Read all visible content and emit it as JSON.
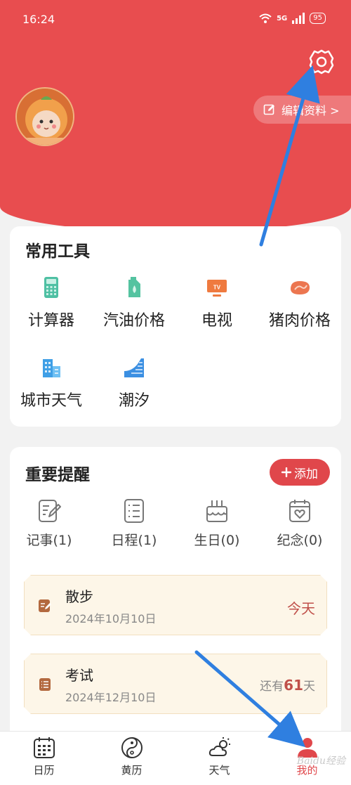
{
  "status_bar": {
    "time": "16:24",
    "network": "5G",
    "battery": "95"
  },
  "profile": {
    "edit_label": "编辑资料 >"
  },
  "tools": {
    "title": "常用工具",
    "items": [
      {
        "label": "计算器",
        "icon": "calculator-icon"
      },
      {
        "label": "汽油价格",
        "icon": "fuel-icon"
      },
      {
        "label": "电视",
        "icon": "tv-icon"
      },
      {
        "label": "猪肉价格",
        "icon": "meat-icon"
      },
      {
        "label": "城市天气",
        "icon": "city-weather-icon"
      },
      {
        "label": "潮汐",
        "icon": "tide-icon"
      }
    ]
  },
  "reminders": {
    "title": "重要提醒",
    "add_label": "添加",
    "categories": [
      {
        "label": "记事(1)",
        "icon": "note-icon"
      },
      {
        "label": "日程(1)",
        "icon": "schedule-icon"
      },
      {
        "label": "生日(0)",
        "icon": "birthday-cake-icon"
      },
      {
        "label": "纪念(0)",
        "icon": "anniversary-icon"
      }
    ],
    "items": [
      {
        "title": "散步",
        "date": "2024年10月10日",
        "right": "今天"
      },
      {
        "title": "考试",
        "date": "2024年12月10日",
        "right_prefix": "还有",
        "right_num": "61",
        "right_suffix": "天"
      }
    ]
  },
  "tabbar": {
    "items": [
      {
        "label": "日历",
        "icon": "calendar-icon"
      },
      {
        "label": "黄历",
        "icon": "yin-yang-icon"
      },
      {
        "label": "天气",
        "icon": "weather-icon"
      },
      {
        "label": "我的",
        "icon": "profile-icon"
      }
    ]
  },
  "watermark": "Baidu经验",
  "colors": {
    "brand_red": "#e84d4f",
    "accent_red": "#e0474b",
    "annotation_arrow": "#2f7fe0"
  }
}
